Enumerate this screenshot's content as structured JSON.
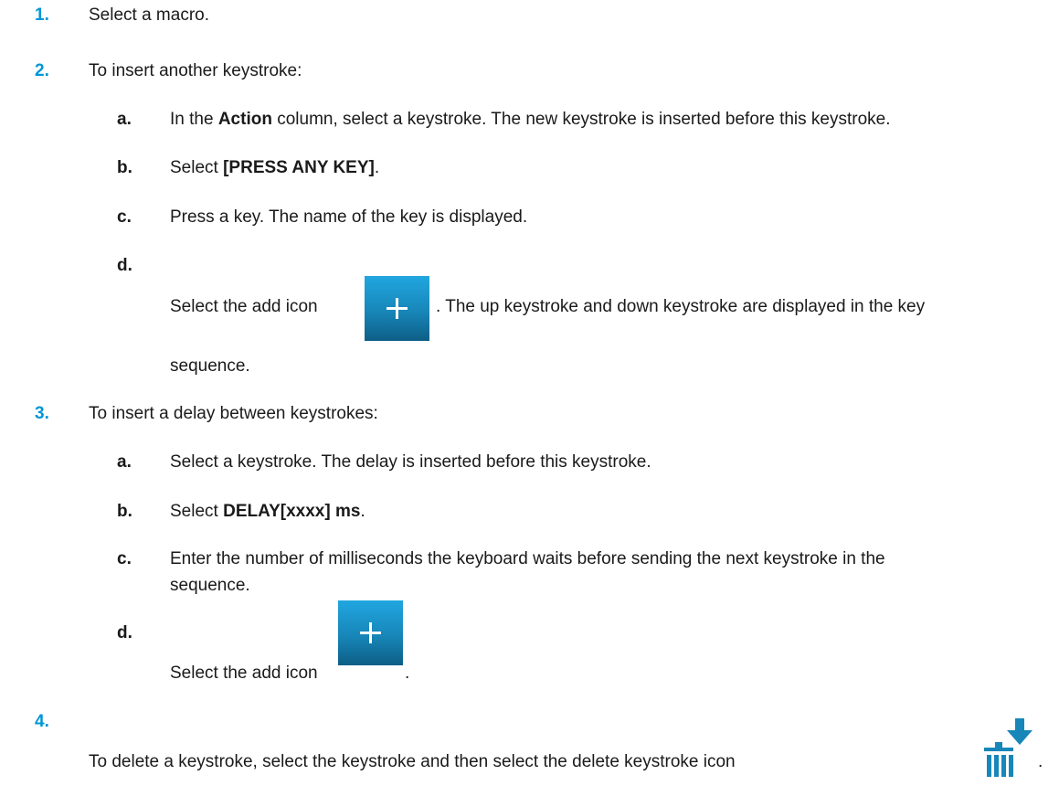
{
  "steps": [
    {
      "num": "1.",
      "text": "Select a macro."
    },
    {
      "num": "2.",
      "text": "To insert another keystroke:",
      "subs": [
        {
          "label": "a.",
          "pre": "In the ",
          "bold": "Action",
          "post": " column, select a keystroke. The new keystroke is inserted before this keystroke."
        },
        {
          "label": "b.",
          "pre": "Select ",
          "bold": "[PRESS ANY KEY]",
          "post": "."
        },
        {
          "label": "c.",
          "text": "Press a key. The name of the key is displayed."
        },
        {
          "label": "d.",
          "pre": "Select the add icon",
          "post": ". The up keystroke and down keystroke are displayed in the key",
          "cont": "sequence."
        }
      ]
    },
    {
      "num": "3.",
      "text": "To insert a delay between keystrokes:",
      "subs": [
        {
          "label": "a.",
          "text": "Select a keystroke. The delay is inserted before this keystroke."
        },
        {
          "label": "b.",
          "pre": "Select ",
          "bold": "DELAY[xxxx] ms",
          "post": "."
        },
        {
          "label": "c.",
          "text": "Enter the number of milliseconds the keyboard waits before sending the next keystroke in the",
          "cont": "sequence."
        },
        {
          "label": "d.",
          "pre": "Select the add icon",
          "post": "."
        }
      ]
    },
    {
      "num": "4.",
      "pre": "To delete a keystroke, select the keystroke and then select the delete keystroke icon",
      "post": "."
    }
  ],
  "icons": {
    "add": "plus-icon",
    "delete_keystroke": "delete-keystroke-icon",
    "colors": {
      "accent": "#0096d6",
      "icon_blue": "#1786b8",
      "text": "#1a1a1a"
    }
  }
}
